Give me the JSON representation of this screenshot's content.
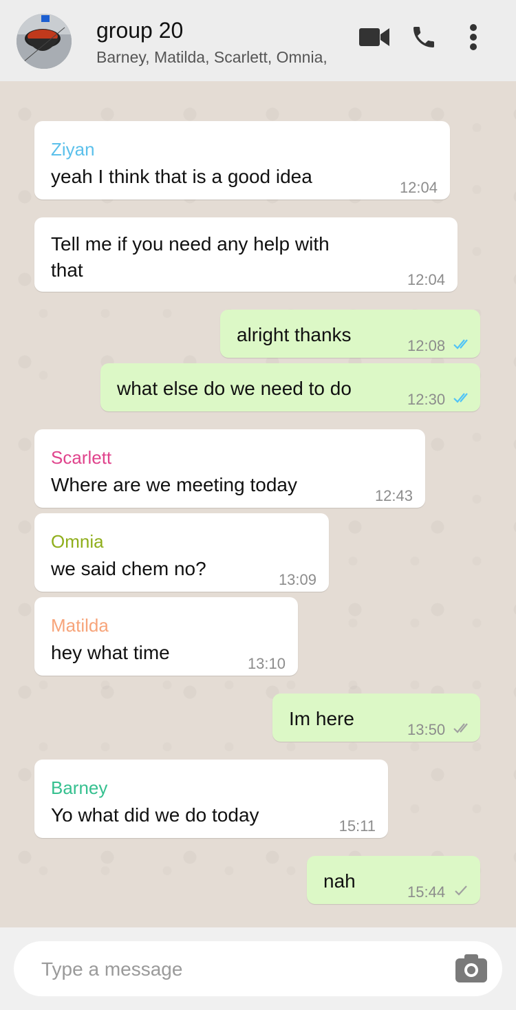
{
  "header": {
    "title": "group 20",
    "members": "Barney, Matilda, Scarlett, Omnia,",
    "icons": [
      "video-call-icon",
      "phone-icon",
      "more-vert-icon"
    ]
  },
  "colors": {
    "incoming": "#ffffff",
    "outgoing": "#dcf8c6",
    "read_tick": "#4fc3f7",
    "unread_tick": "#a0a0a0"
  },
  "messages": [
    {
      "direction": "in",
      "sender": "Ziyan",
      "sender_color": "#5bc0eb",
      "text": "yeah I think that is a good idea",
      "time": "12:04"
    },
    {
      "direction": "in",
      "sender": "",
      "text": "Tell me if you need any help with that",
      "time": "12:04"
    },
    {
      "direction": "out",
      "text": "alright thanks",
      "time": "12:08",
      "status": "read"
    },
    {
      "direction": "out",
      "text": "what else do we need to do",
      "time": "12:30",
      "status": "read"
    },
    {
      "direction": "in",
      "sender": "Scarlett",
      "sender_color": "#e0438c",
      "text": "Where are we meeting today",
      "time": "12:43"
    },
    {
      "direction": "in",
      "sender": "Omnia",
      "sender_color": "#8fae1b",
      "text": "we said chem no?",
      "time": "13:09"
    },
    {
      "direction": "in",
      "sender": "Matilda",
      "sender_color": "#f7a47a",
      "text": "hey what time",
      "time": "13:10"
    },
    {
      "direction": "out",
      "text": "Im here",
      "time": "13:50",
      "status": "delivered"
    },
    {
      "direction": "in",
      "sender": "Barney",
      "sender_color": "#35c08f",
      "text": "Yo what did we do today",
      "time": "15:11"
    },
    {
      "direction": "out",
      "text": "nah",
      "time": "15:44",
      "status": "sent"
    }
  ],
  "composer": {
    "placeholder": "Type a message"
  }
}
